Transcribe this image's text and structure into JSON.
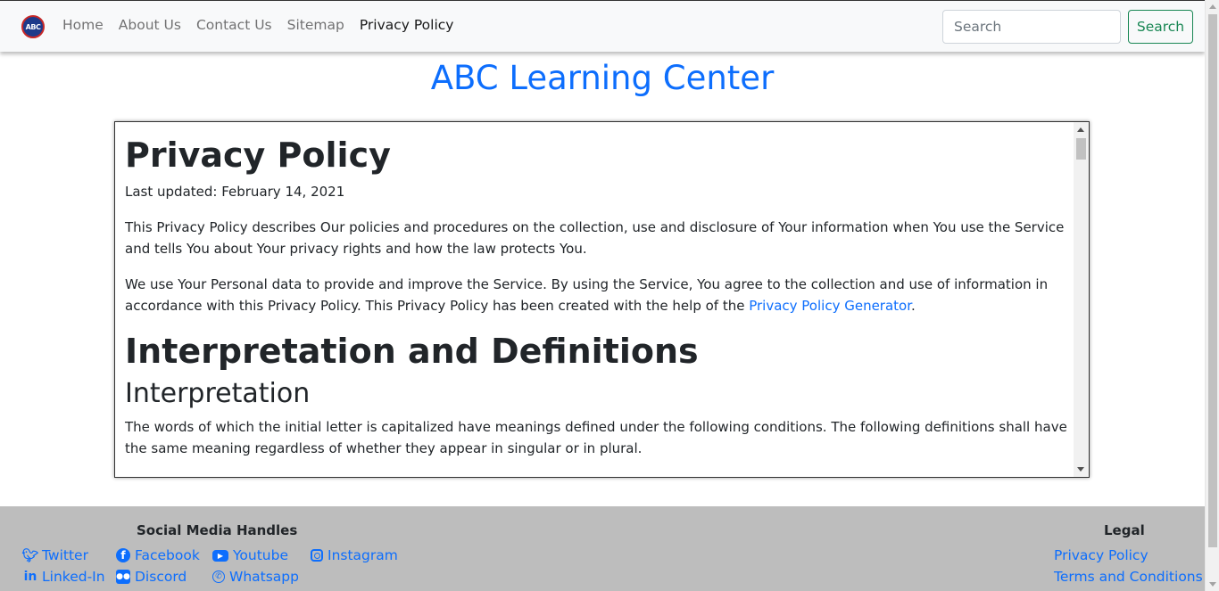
{
  "navbar": {
    "logo_text": "ABC",
    "links": [
      {
        "label": "Home"
      },
      {
        "label": "About Us"
      },
      {
        "label": "Contact Us"
      },
      {
        "label": "Sitemap"
      },
      {
        "label": "Privacy Policy",
        "active": true
      }
    ],
    "search_placeholder": "Search",
    "search_button": "Search"
  },
  "site_title": "ABC Learning Center",
  "policy": {
    "heading": "Privacy Policy",
    "last_updated": "Last updated: February 14, 2021",
    "para1": "This Privacy Policy describes Our policies and procedures on the collection, use and disclosure of Your information when You use the Service and tells You about Your privacy rights and how the law protects You.",
    "para2_before_link": "We use Your Personal data to provide and improve the Service. By using the Service, You agree to the collection and use of information in accordance with this Privacy Policy. This Privacy Policy has been created with the help of the ",
    "para2_link": "Privacy Policy Generator",
    "para2_after_link": ".",
    "section_heading": "Interpretation and Definitions",
    "subsection_heading": "Interpretation",
    "para3": "The words of which the initial letter is capitalized have meanings defined under the following conditions. The following definitions shall have the same meaning regardless of whether they appear in singular or in plural."
  },
  "footer": {
    "social_heading": "Social Media Handles",
    "legal_heading": "Legal",
    "social_links": [
      {
        "label": "Twitter",
        "icon": "twitter-icon"
      },
      {
        "label": "Facebook",
        "icon": "facebook-icon"
      },
      {
        "label": "Youtube",
        "icon": "youtube-icon"
      },
      {
        "label": "Instagram",
        "icon": "instagram-icon"
      },
      {
        "label": "Linked-In",
        "icon": "linkedin-icon"
      },
      {
        "label": "Discord",
        "icon": "discord-icon"
      },
      {
        "label": "Whatsapp",
        "icon": "whatsapp-icon"
      }
    ],
    "legal_links": [
      {
        "label": "Privacy Policy"
      },
      {
        "label": "Terms and Conditions"
      }
    ]
  },
  "colors": {
    "primary": "#0d6efd",
    "success": "#198754",
    "footer_bg": "#bdbdbd",
    "navbar_bg": "#f8f9fa"
  }
}
